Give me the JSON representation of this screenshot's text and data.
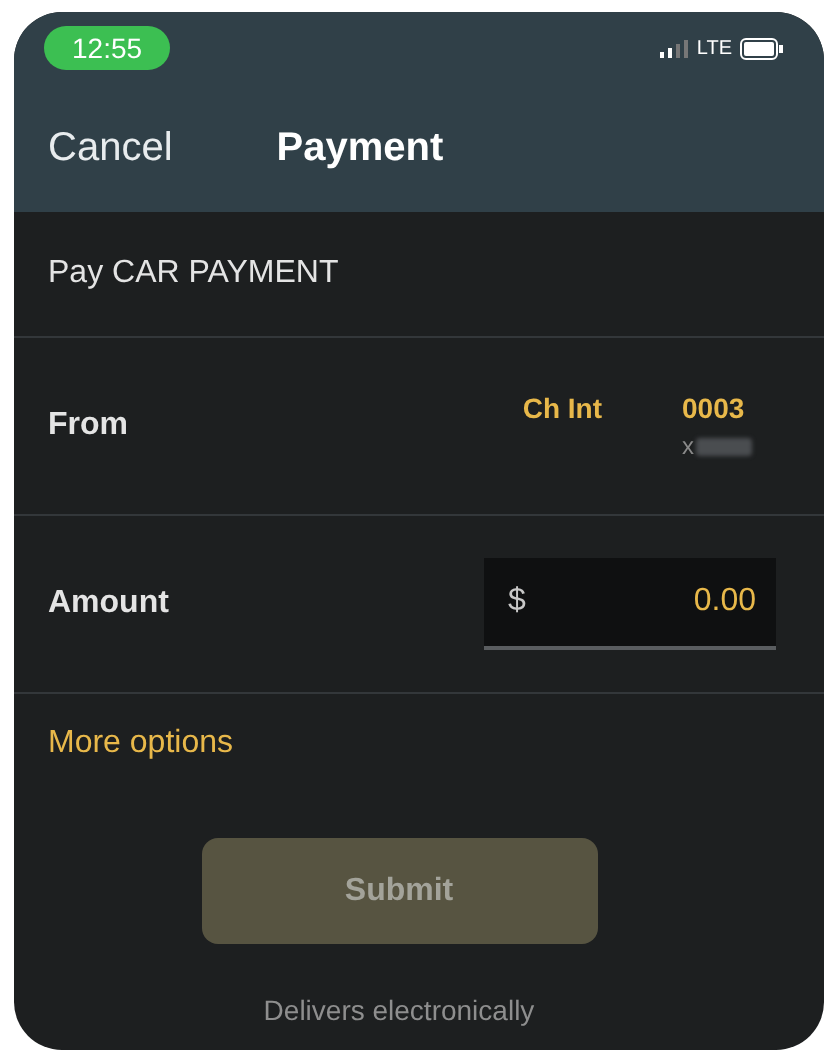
{
  "status_bar": {
    "time": "12:55",
    "network": "LTE"
  },
  "nav": {
    "cancel": "Cancel",
    "title": "Payment"
  },
  "payee": "Pay CAR PAYMENT",
  "from": {
    "label": "From",
    "account_name": "Ch Int",
    "account_number": "0003",
    "masked_prefix": "x"
  },
  "amount": {
    "label": "Amount",
    "currency": "$",
    "value": "0.00"
  },
  "more_options": "More options",
  "submit": {
    "label": "Submit",
    "disabled": true
  },
  "footnote": "Delivers electronically"
}
